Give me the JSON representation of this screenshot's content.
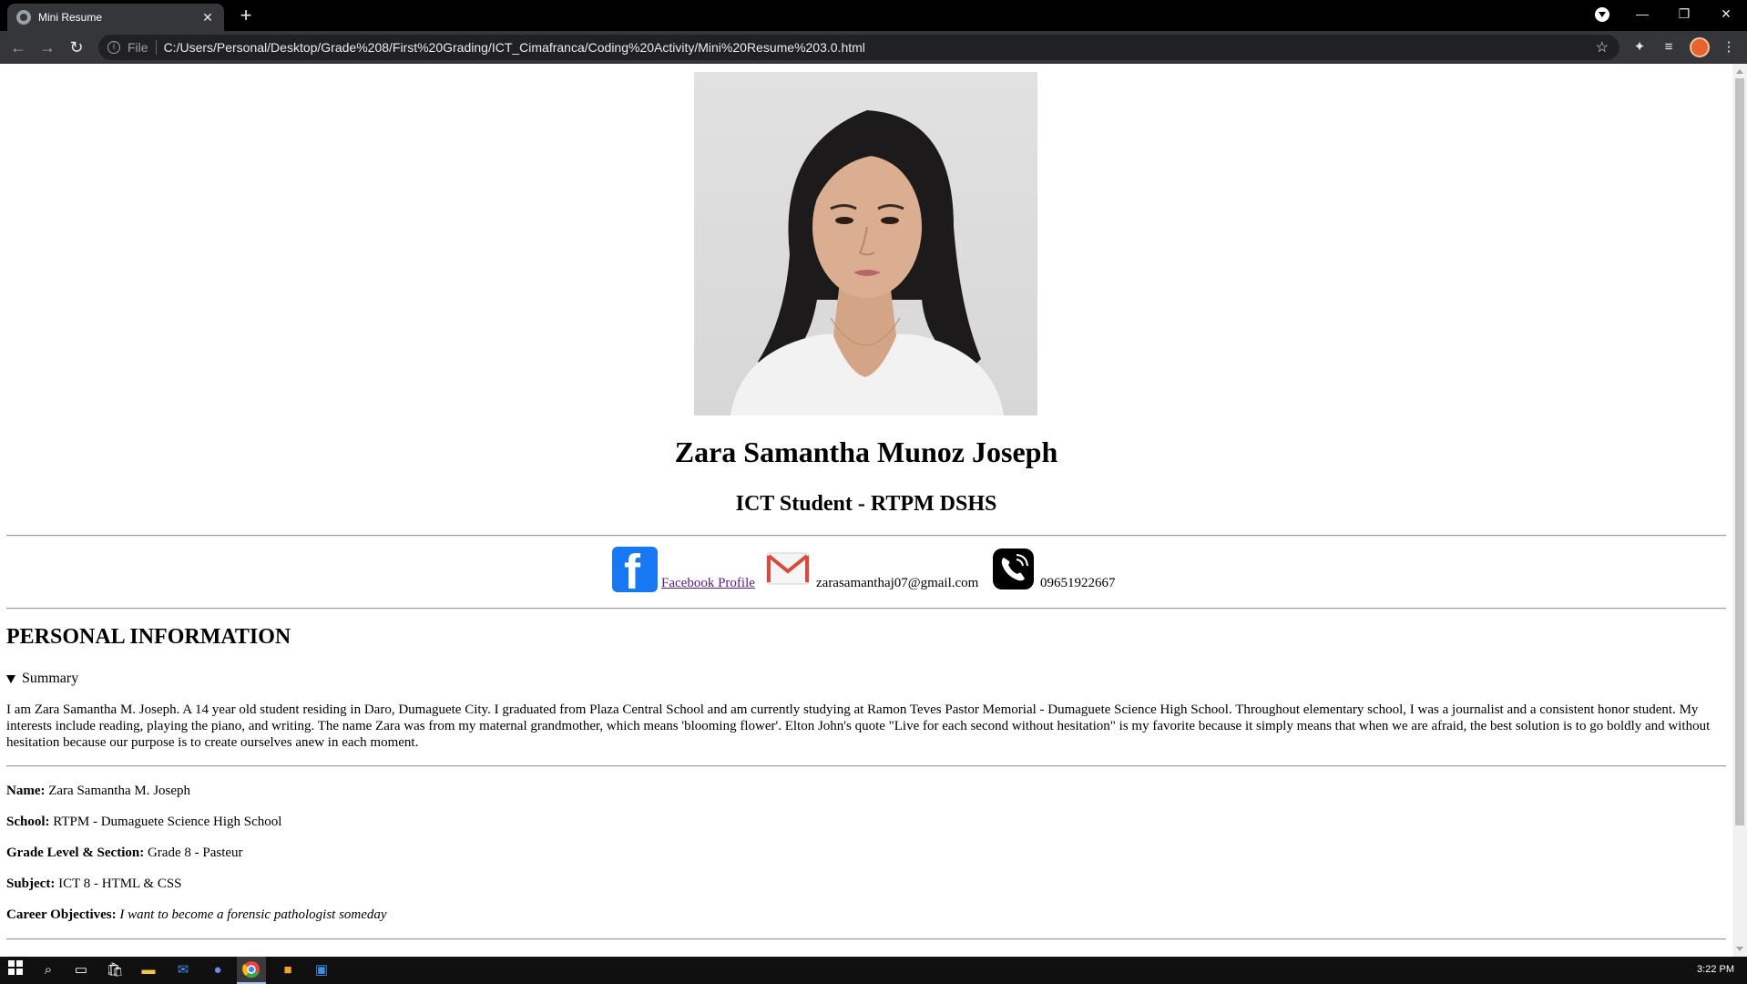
{
  "browser": {
    "tab_title": "Mini Resume",
    "tab_close": "✕",
    "new_tab": "+",
    "scheme": "File",
    "url": "C:/Users/Personal/Desktop/Grade%208/First%20Grading/ICT_Cimafranca/Coding%20Activity/Mini%20Resume%203.0.html",
    "back": "←",
    "forward": "→",
    "reload": "↻",
    "star": "☆",
    "minimize": "—",
    "restore": "❐",
    "close": "✕"
  },
  "page": {
    "name": "Zara Samantha Munoz Joseph",
    "role": "ICT Student - RTPM DSHS",
    "contacts": {
      "facebook_label": "Facebook Profile ",
      "email": "zarasamanthaj07@gmail.com",
      "phone": "09651922667"
    },
    "section_title": "PERSONAL INFORMATION",
    "summary_label": "Summary",
    "summary_text": "I am Zara Samantha M. Joseph. A 14 year old student residing in Daro, Dumaguete City. I graduated from Plaza Central School and am currently studying at Ramon Teves Pastor Memorial - Dumaguete Science High School. Throughout elementary school, I was a journalist and a consistent honor student. My interests include reading, playing the piano, and writing. The name Zara was from my maternal grandmother, which means 'blooming flower'. Elton John's quote \"Live for each second without hesitation\" is my favorite because it simply means that when we are afraid, the best solution is to go boldly and without hesitation because our purpose is to create ourselves anew in each moment.",
    "fields": [
      {
        "label": "Name:",
        "value": " Zara Samantha M. Joseph"
      },
      {
        "label": "School:",
        "value": " RTPM - Dumaguete Science High School"
      },
      {
        "label": "Grade Level & Section:",
        "value": " Grade 8 - Pasteur"
      },
      {
        "label": "Subject:",
        "value": " ICT 8 - HTML & CSS"
      },
      {
        "label": "Career Objectives:",
        "value": "I want to become a forensic pathologist someday"
      }
    ]
  },
  "taskbar": {
    "clock": "3:22 PM"
  }
}
